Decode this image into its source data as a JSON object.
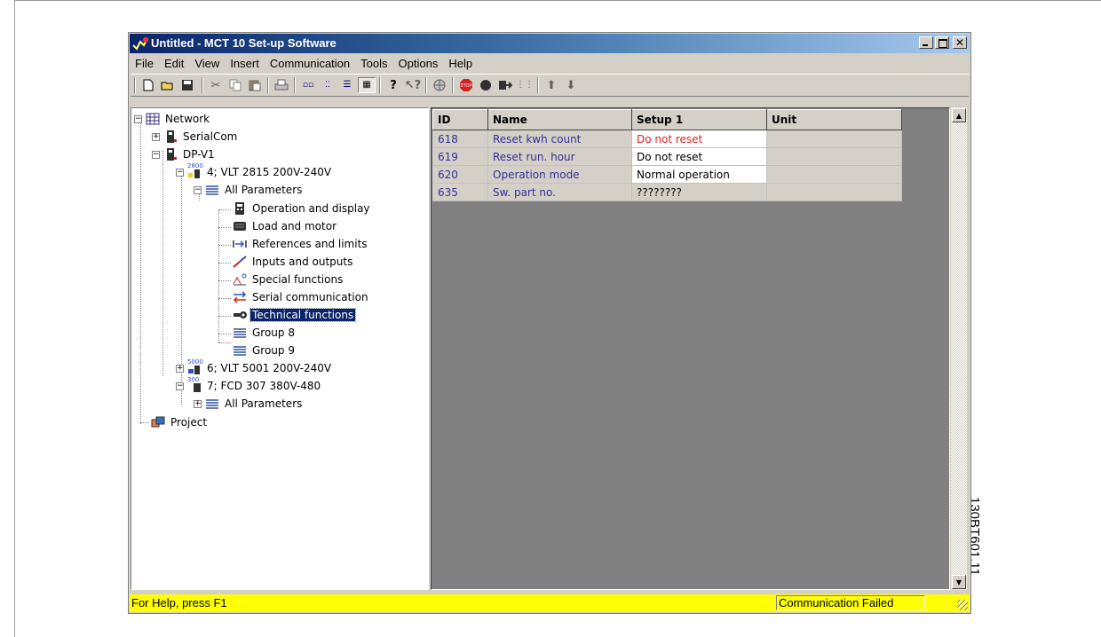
{
  "window": {
    "title": "Untitled - MCT 10 Set-up Software"
  },
  "menu": [
    "File",
    "Edit",
    "View",
    "Insert",
    "Communication",
    "Tools",
    "Options",
    "Help"
  ],
  "toolbar": {
    "icons": [
      "new-icon",
      "open-icon",
      "save-icon",
      "cut-icon",
      "copy-icon",
      "paste-icon",
      "print-icon",
      "large-icons-icon",
      "small-icons-icon",
      "list-icon",
      "details-icon",
      "help-icon",
      "context-help-icon",
      "network-icon",
      "stop-icon",
      "record-icon",
      "send-icon",
      "compare-icon",
      "up-arrow-icon",
      "down-arrow-icon"
    ]
  },
  "tree": {
    "network": "Network",
    "serialcom": "SerialCom",
    "dpv1": "DP-V1",
    "vlt2815": "4; VLT 2815 200V-240V",
    "all_params": "All Parameters",
    "groups": [
      "Operation and display",
      "Load and motor",
      "References and limits",
      "Inputs and outputs",
      "Special functions",
      "Serial communication",
      "Technical functions",
      "Group 8",
      "Group 9"
    ],
    "selected": "Technical functions",
    "vlt5001": "6; VLT 5001 200V-240V",
    "fcd307": "7; FCD 307 380V-480",
    "all_params_2": "All Parameters",
    "project": "Project",
    "badge_2800": "2800",
    "badge_5000": "5000",
    "badge_300": "300"
  },
  "grid": {
    "columns": [
      "ID",
      "Name",
      "Setup 1",
      "Unit"
    ],
    "rows": [
      {
        "id": "618",
        "name": "Reset kwh count",
        "setup": "Do not reset",
        "unit": ""
      },
      {
        "id": "619",
        "name": "Reset run. hour",
        "setup": "Do not reset",
        "unit": ""
      },
      {
        "id": "620",
        "name": "Operation mode",
        "setup": "Normal operation",
        "unit": ""
      },
      {
        "id": "635",
        "name": "Sw. part no.",
        "setup": "????????",
        "unit": ""
      }
    ]
  },
  "status": {
    "help": "For Help, press F1",
    "comm": "Communication Failed"
  },
  "side_code": "130BT601.11",
  "colors": {
    "titlebar": "#0a246a",
    "status_bar": "#ffff00",
    "selection": "#0a246a",
    "modified_value": "#e02020",
    "id_text": "#30309a"
  }
}
